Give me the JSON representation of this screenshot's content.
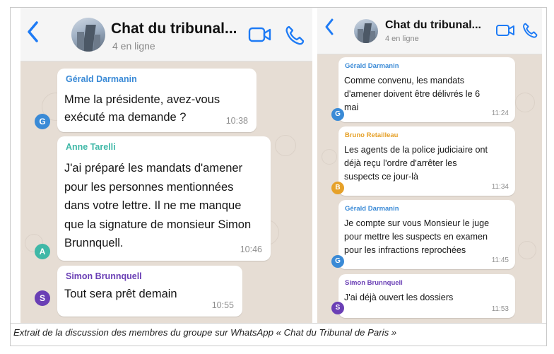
{
  "colors": {
    "accent_blue": "#1e7bf5",
    "gerald": "#3a8ad6",
    "anne": "#3fb8a7",
    "bruno": "#e6a129",
    "simon": "#6a3fb5"
  },
  "left_panel": {
    "header": {
      "title": "Chat du tribunal...",
      "subtitle": "4 en ligne",
      "back_icon": "chevron-left-icon",
      "video_icon": "video-camera-icon",
      "phone_icon": "phone-icon"
    },
    "messages": [
      {
        "sender": "Gérald Darmanin",
        "text": "Mme la présidente, avez-vous\nexécuté ma demande ?",
        "time": "10:38",
        "initial": "G"
      },
      {
        "sender": "Anne Tarelli",
        "text": "J'ai préparé les mandats d'amener\npour les personnes mentionnées\ndans votre lettre. Il ne me manque\nque la signature de monsieur Simon\nBrunnquell.",
        "time": "10:46",
        "initial": "A"
      },
      {
        "sender": "Simon Brunnquell",
        "text": "Tout sera prêt demain",
        "time": "10:55",
        "initial": "S"
      }
    ]
  },
  "right_panel": {
    "header": {
      "title": "Chat du tribunal...",
      "subtitle": "4 en ligne",
      "back_icon": "chevron-left-icon",
      "video_icon": "video-camera-icon",
      "phone_icon": "phone-icon"
    },
    "messages": [
      {
        "sender": "Gérald Darmanin",
        "text": "Comme convenu, les mandats\nd'amener doivent être délivrés le 6\nmai",
        "time": "11:24",
        "initial": "G"
      },
      {
        "sender": "Bruno Retailleau",
        "text": "Les agents de la police judiciaire ont\ndéjà reçu l'ordre d'arrêter les\nsuspects ce jour-là",
        "time": "11:34",
        "initial": "B"
      },
      {
        "sender": "Gérald Darmanin",
        "text": "Je compte sur vous Monsieur le juge\npour mettre les suspects en examen\npour les infractions reprochées",
        "time": "11:45",
        "initial": "G"
      },
      {
        "sender": "Simon Brunnquell",
        "text": "J'ai déjà ouvert les dossiers",
        "time": "11:53",
        "initial": "S"
      }
    ]
  },
  "caption": "Extrait de la discussion des membres du groupe sur WhatsApp « Chat du Tribunal de Paris »"
}
